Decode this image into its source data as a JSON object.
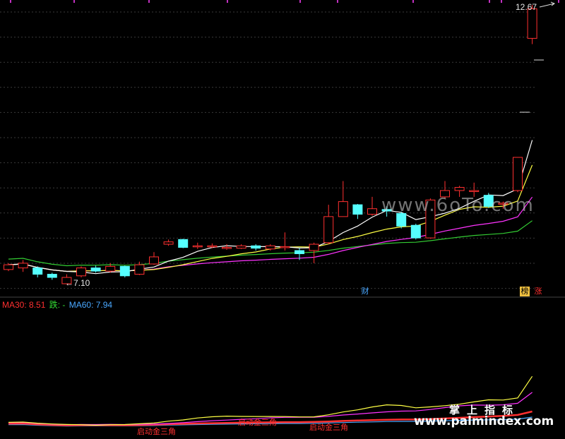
{
  "chart_data": {
    "type": "candlestick",
    "price_high_label": "12.67",
    "price_low_label": "7.10",
    "candles": [
      {
        "o": 7.28,
        "c": 7.34,
        "h": 7.36,
        "l": 7.26
      },
      {
        "o": 7.3,
        "c": 7.36,
        "h": 7.4,
        "l": 7.25
      },
      {
        "o": 7.3,
        "c": 7.22,
        "h": 7.32,
        "l": 7.18
      },
      {
        "o": 7.22,
        "c": 7.18,
        "h": 7.24,
        "l": 7.15
      },
      {
        "o": 7.1,
        "c": 7.18,
        "h": 7.22,
        "l": 7.1
      },
      {
        "o": 7.2,
        "c": 7.3,
        "h": 7.32,
        "l": 7.18
      },
      {
        "o": 7.3,
        "c": 7.26,
        "h": 7.33,
        "l": 7.24
      },
      {
        "o": 7.26,
        "c": 7.32,
        "h": 7.36,
        "l": 7.24
      },
      {
        "o": 7.32,
        "c": 7.2,
        "h": 7.33,
        "l": 7.18
      },
      {
        "o": 7.22,
        "c": 7.34,
        "h": 7.38,
        "l": 7.21
      },
      {
        "o": 7.35,
        "c": 7.44,
        "h": 7.5,
        "l": 7.34
      },
      {
        "o": 7.6,
        "c": 7.63,
        "h": 7.66,
        "l": 7.58
      },
      {
        "o": 7.66,
        "c": 7.56,
        "h": 7.67,
        "l": 7.55
      },
      {
        "o": 7.58,
        "c": 7.58,
        "h": 7.62,
        "l": 7.54
      },
      {
        "o": 7.58,
        "c": 7.58,
        "h": 7.61,
        "l": 7.55
      },
      {
        "o": 7.56,
        "c": 7.56,
        "h": 7.6,
        "l": 7.53
      },
      {
        "o": 7.55,
        "c": 7.58,
        "h": 7.6,
        "l": 7.54
      },
      {
        "o": 7.58,
        "c": 7.55,
        "h": 7.6,
        "l": 7.52
      },
      {
        "o": 7.54,
        "c": 7.58,
        "h": 7.6,
        "l": 7.52
      },
      {
        "o": 7.57,
        "c": 7.57,
        "h": 7.75,
        "l": 7.52
      },
      {
        "o": 7.52,
        "c": 7.48,
        "h": 7.55,
        "l": 7.4
      },
      {
        "o": 7.52,
        "c": 7.6,
        "h": 7.62,
        "l": 7.36
      },
      {
        "o": 7.62,
        "c": 7.95,
        "h": 8.1,
        "l": 7.6
      },
      {
        "o": 7.95,
        "c": 8.14,
        "h": 8.4,
        "l": 7.95
      },
      {
        "o": 8.1,
        "c": 7.98,
        "h": 8.11,
        "l": 7.92
      },
      {
        "o": 7.98,
        "c": 8.05,
        "h": 8.2,
        "l": 7.96
      },
      {
        "o": 8.04,
        "c": 8.02,
        "h": 8.08,
        "l": 7.95
      },
      {
        "o": 7.99,
        "c": 7.83,
        "h": 8.01,
        "l": 7.8
      },
      {
        "o": 7.84,
        "c": 7.68,
        "h": 7.86,
        "l": 7.66
      },
      {
        "o": 7.68,
        "c": 8.16,
        "h": 8.18,
        "l": 7.67
      },
      {
        "o": 8.2,
        "c": 8.28,
        "h": 8.4,
        "l": 8.18
      },
      {
        "o": 8.28,
        "c": 8.32,
        "h": 8.34,
        "l": 8.2
      },
      {
        "o": 8.28,
        "c": 8.28,
        "h": 8.38,
        "l": 8.2
      },
      {
        "o": 8.22,
        "c": 8.08,
        "h": 8.25,
        "l": 8.06
      },
      {
        "o": 8.12,
        "c": 8.12,
        "h": 8.14,
        "l": 8.05
      },
      {
        "o": 8.28,
        "c": 8.7,
        "h": 8.7,
        "l": 8.26
      },
      {
        "o": 11.8,
        "c": 12.57,
        "h": 12.67,
        "l": 11.65
      }
    ],
    "lower_panel": {
      "legend": {
        "ma30": "MA30: 8.51",
        "die": "跌: -",
        "ma60": "MA60: 7.94"
      },
      "signal_labels": [
        "启动金三角",
        "启动金三角",
        "启动金三角"
      ]
    },
    "badges": {
      "cai": "财",
      "bang": "榜",
      "zhang": "涨"
    },
    "colors": {
      "up": "#ff3030",
      "down": "#55ffff",
      "ma_white": "#ffffff",
      "ma_yellow": "#ffff44",
      "ma_magenta": "#ff33ff",
      "ma_green": "#33cc33",
      "ma_blue": "#4aa8ff"
    }
  },
  "watermarks": {
    "top": "www.6oTo.com",
    "cn": "掌上指标",
    "url": "www.palmindex.com"
  }
}
